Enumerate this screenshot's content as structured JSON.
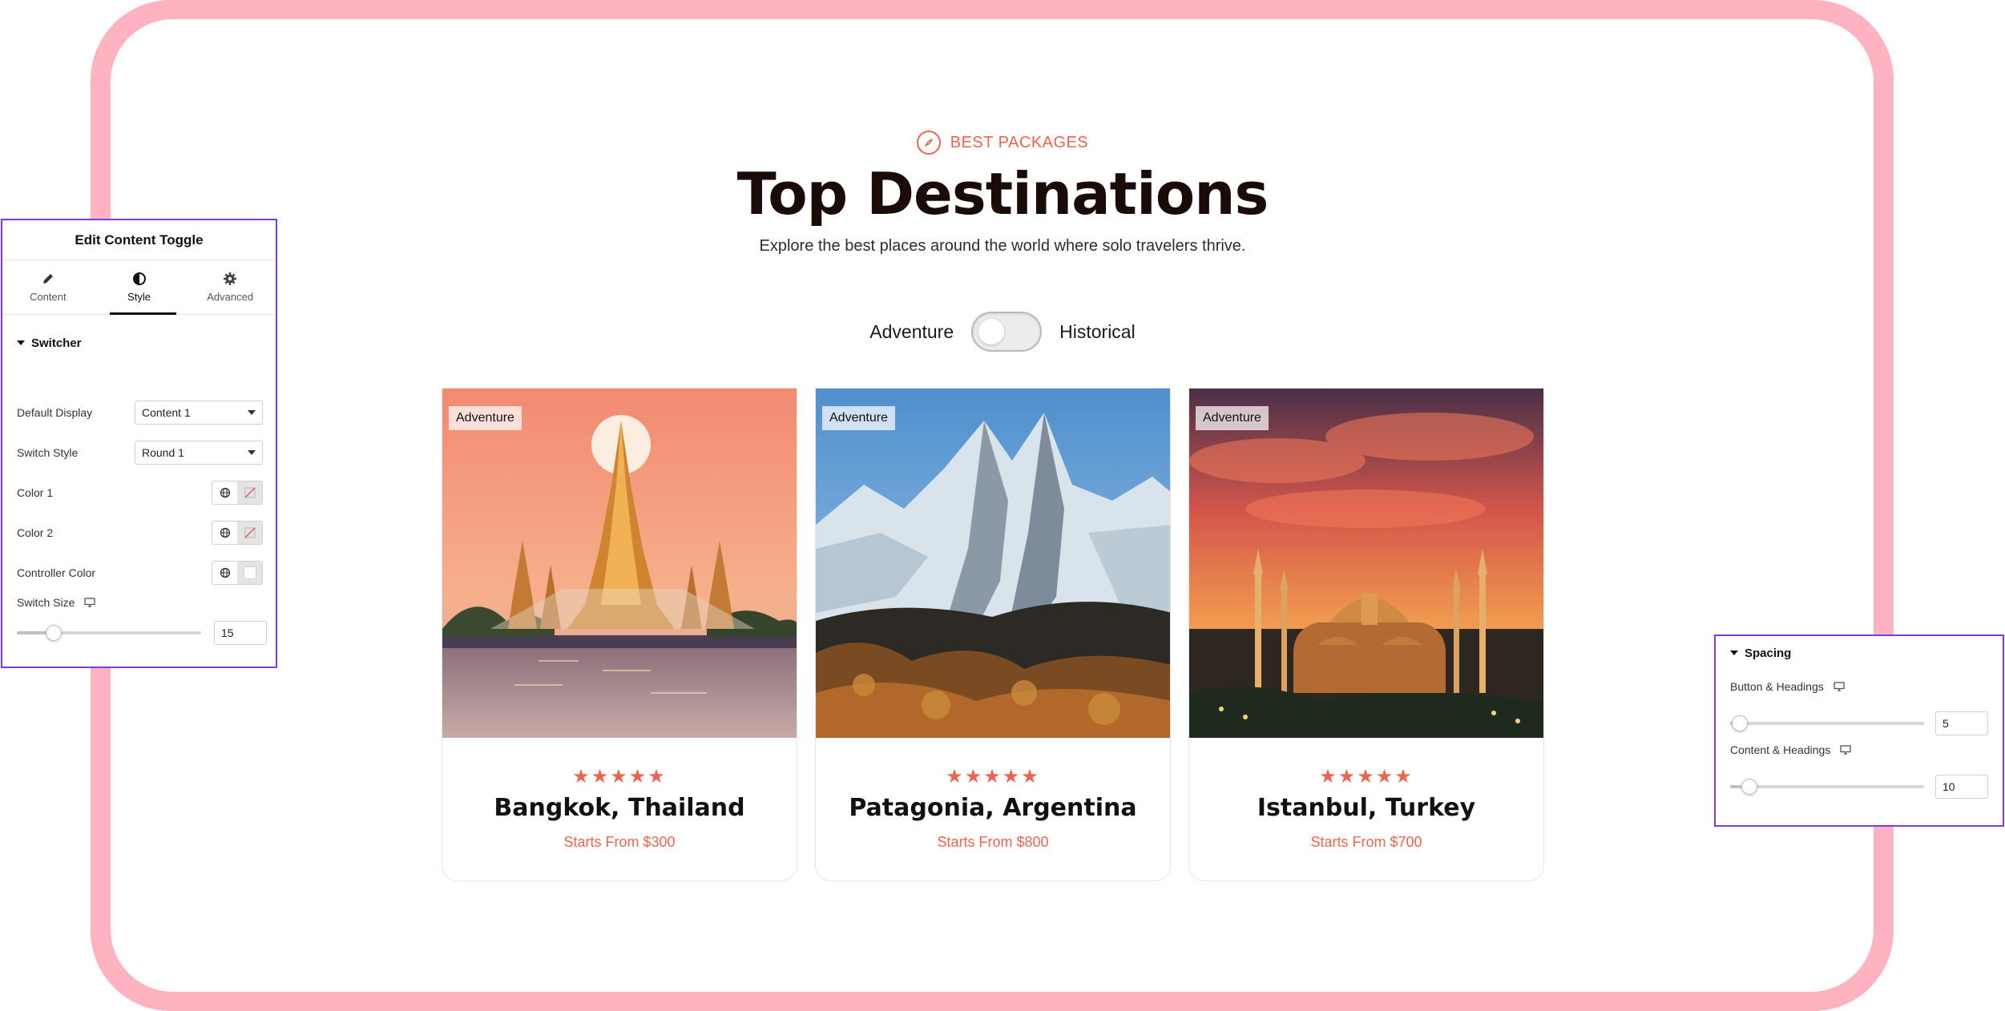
{
  "hero": {
    "kicker": "BEST PACKAGES",
    "title": "Top Destinations",
    "subtitle": "Explore the best places around the world where solo travelers thrive."
  },
  "toggle": {
    "left_label": "Adventure",
    "right_label": "Historical",
    "state": "Adventure"
  },
  "cards": [
    {
      "tag": "Adventure",
      "title": "Bangkok, Thailand",
      "price": "Starts From $300",
      "rating": 5,
      "image": "wat-arun-temple-sunset"
    },
    {
      "tag": "Adventure",
      "title": "Patagonia, Argentina",
      "price": "Starts From $800",
      "rating": 5,
      "image": "patagonia-snowy-peaks"
    },
    {
      "tag": "Adventure",
      "title": "Istanbul, Turkey",
      "price": "Starts From $700",
      "rating": 5,
      "image": "hagia-sophia-dusk"
    }
  ],
  "editor": {
    "title": "Edit Content Toggle",
    "tabs": [
      {
        "label": "Content",
        "icon": "pencil-icon"
      },
      {
        "label": "Style",
        "icon": "half-circle-icon",
        "active": true
      },
      {
        "label": "Advanced",
        "icon": "gear-icon"
      }
    ],
    "section": "Switcher",
    "default_display": {
      "label": "Default Display",
      "value": "Content 1"
    },
    "switch_style": {
      "label": "Switch Style",
      "value": "Round 1"
    },
    "color1": {
      "label": "Color 1"
    },
    "color2": {
      "label": "Color 2"
    },
    "controller_color": {
      "label": "Controller Color"
    },
    "switch_size": {
      "label": "Switch Size",
      "value": "15"
    }
  },
  "spacing": {
    "section": "Spacing",
    "button_headings": {
      "label": "Button & Headings",
      "value": "5"
    },
    "content_headings": {
      "label": "Content & Headings",
      "value": "10"
    }
  },
  "colors": {
    "accent": "#ea6550",
    "frame": "#ffb3c0",
    "panel_border": "#7c3aed"
  }
}
